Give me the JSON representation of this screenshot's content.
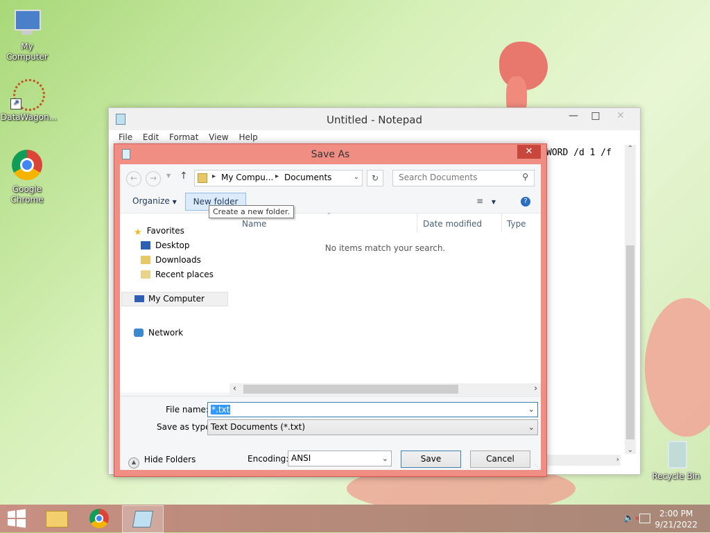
{
  "desktop": {
    "icons": [
      {
        "label": "My Computer",
        "icon": "my-computer-icon"
      },
      {
        "label": "DataWagon...",
        "icon": "datawagon-icon"
      },
      {
        "label": "Google Chrome",
        "icon": "chrome-icon"
      },
      {
        "label": "Recycle Bin",
        "icon": "recycle-bin-icon"
      }
    ]
  },
  "notepad": {
    "title": "Untitled - Notepad",
    "menu": [
      "File",
      "Edit",
      "Format",
      "View",
      "Help"
    ],
    "text": "WORD /d 1 /f"
  },
  "dialog": {
    "title": "Save As",
    "breadcrumb": [
      "My Compu...",
      "Documents"
    ],
    "search_placeholder": "Search Documents",
    "organize_label": "Organize",
    "new_folder_label": "New folder",
    "tooltip": "Create a new folder.",
    "nav": {
      "favorites": "Favorites",
      "desktop": "Desktop",
      "downloads": "Downloads",
      "recent": "Recent places",
      "my_computer": "My Computer",
      "network": "Network"
    },
    "columns": {
      "name": "Name",
      "date": "Date modified",
      "type": "Type"
    },
    "empty_message": "No items match your search.",
    "file_name_label": "File name:",
    "file_name_value": "*.txt",
    "save_type_label": "Save as type:",
    "save_type_value": "Text Documents (*.txt)",
    "hide_folders_label": "Hide Folders",
    "encoding_label": "Encoding:",
    "encoding_value": "ANSI",
    "save_label": "Save",
    "cancel_label": "Cancel"
  },
  "taskbar": {
    "time": "2:00 PM",
    "date": "9/21/2022"
  }
}
